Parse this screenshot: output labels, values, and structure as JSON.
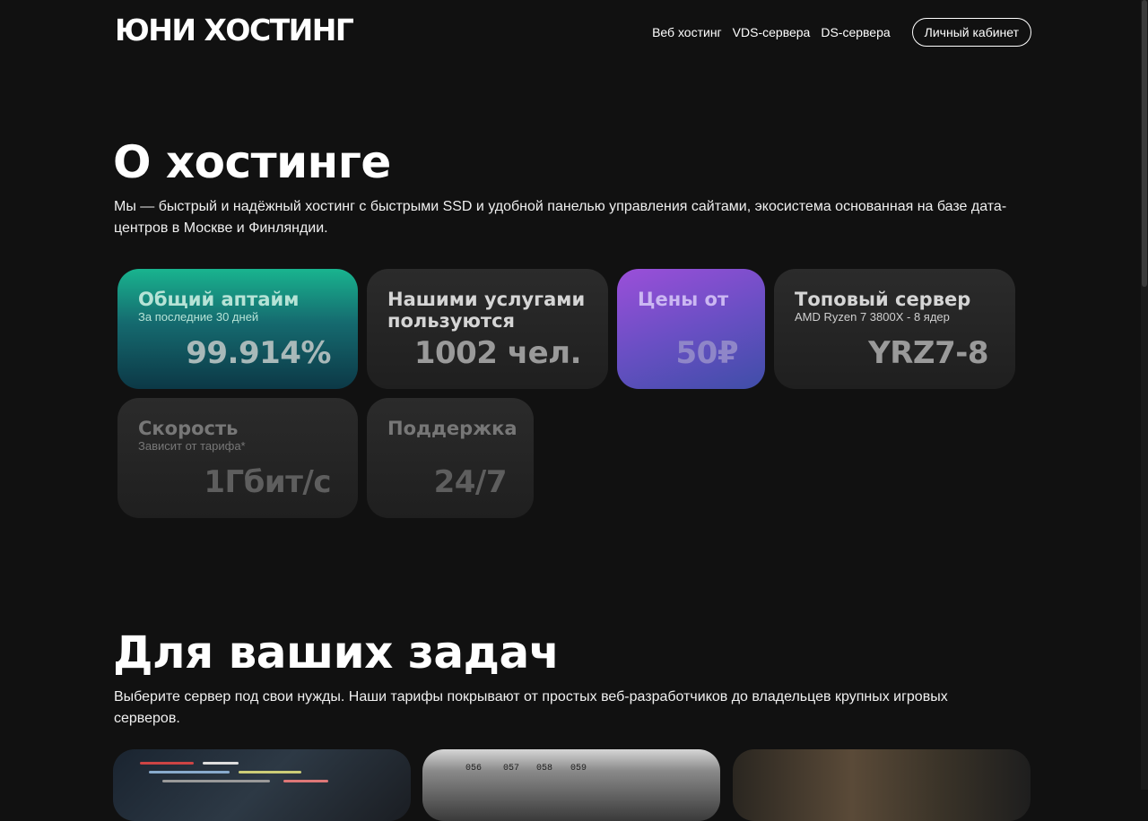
{
  "header": {
    "logo": "ЮНИ ХОСТИНГ",
    "nav": [
      "Веб хостинг",
      "VDS-сервера",
      "DS-сервера"
    ],
    "cabinet": "Личный кабинет"
  },
  "about": {
    "title": "О хостинге",
    "description": "Мы — быстрый и надёжный хостинг с быстрыми SSD и удобной панелью управления сайтами, экосистема основанная на базе дата-центров в Москве и Финляндии."
  },
  "stats": [
    {
      "title": "Общий аптайм",
      "subtitle": "За последние 30 дней",
      "value": "99.914%"
    },
    {
      "title": "Нашими услугами пользуются",
      "subtitle": "",
      "value": "1002 чел."
    },
    {
      "title": "Цены от",
      "subtitle": "",
      "value": "50₽"
    },
    {
      "title": "Топовый сервер",
      "subtitle": "AMD Ryzen 7 3800X - 8 ядер",
      "value": "YRZ7-8"
    },
    {
      "title": "Скорость",
      "subtitle": "Зависит от тарифа*",
      "value": "1Гбит/с"
    },
    {
      "title": "Поддержка",
      "subtitle": "",
      "value": "24/7"
    }
  ],
  "tasks": {
    "title": "Для ваших задач",
    "description": "Выберите сервер под свои нужды. Наши тарифы покрывают от простых веб-разработчиков до владельцев крупных игровых серверов.",
    "rack_labels": [
      "056",
      "057",
      "058",
      "059"
    ]
  }
}
